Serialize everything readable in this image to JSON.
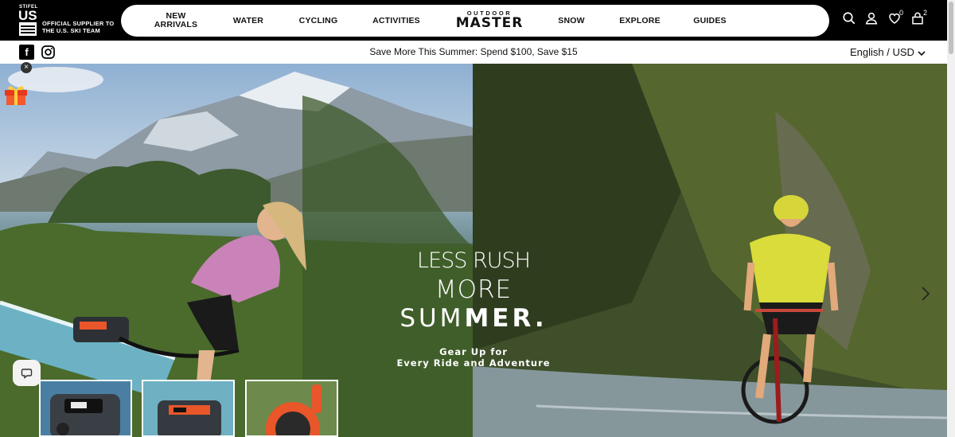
{
  "header": {
    "badge": {
      "stifel": "STIFEL",
      "us": "US",
      "ski_team": "SKI TEAM"
    },
    "supplier_text": "OFFICIAL SUPPLIER TO THE U.S. SKI TEAM",
    "nav": [
      {
        "label": "NEW ARRIVALS"
      },
      {
        "label": "WATER"
      },
      {
        "label": "CYCLING"
      },
      {
        "label": "ACTIVITIES"
      },
      {
        "label": "SNOW"
      },
      {
        "label": "EXPLORE"
      },
      {
        "label": "GUIDES"
      }
    ],
    "logo": {
      "top": "OUTDOOR",
      "main": "MASTER"
    },
    "wishlist_count": "0",
    "cart_count": "2"
  },
  "announcement": {
    "text": "Save More This Summer: Spend $100, Save $15",
    "language": "English / USD",
    "facebook": "f"
  },
  "hero": {
    "line1": "LESS RUSH",
    "line2": "MORE",
    "line3_light": "SUM",
    "line3_bold": "MER.",
    "subtitle_line1": "Gear Up for",
    "subtitle_line2": "Every Ride and Adventure"
  },
  "widgets": {
    "close_label": "×"
  },
  "colors": {
    "header_bg": "#000000",
    "nav_bg": "#ffffff",
    "accent_orange": "#e8562a"
  },
  "icons": [
    "facebook-icon",
    "instagram-icon",
    "search-icon",
    "account-icon",
    "heart-icon",
    "bag-icon",
    "chevron-down-icon",
    "chevron-right-icon",
    "gift-icon",
    "chat-icon",
    "close-icon"
  ]
}
